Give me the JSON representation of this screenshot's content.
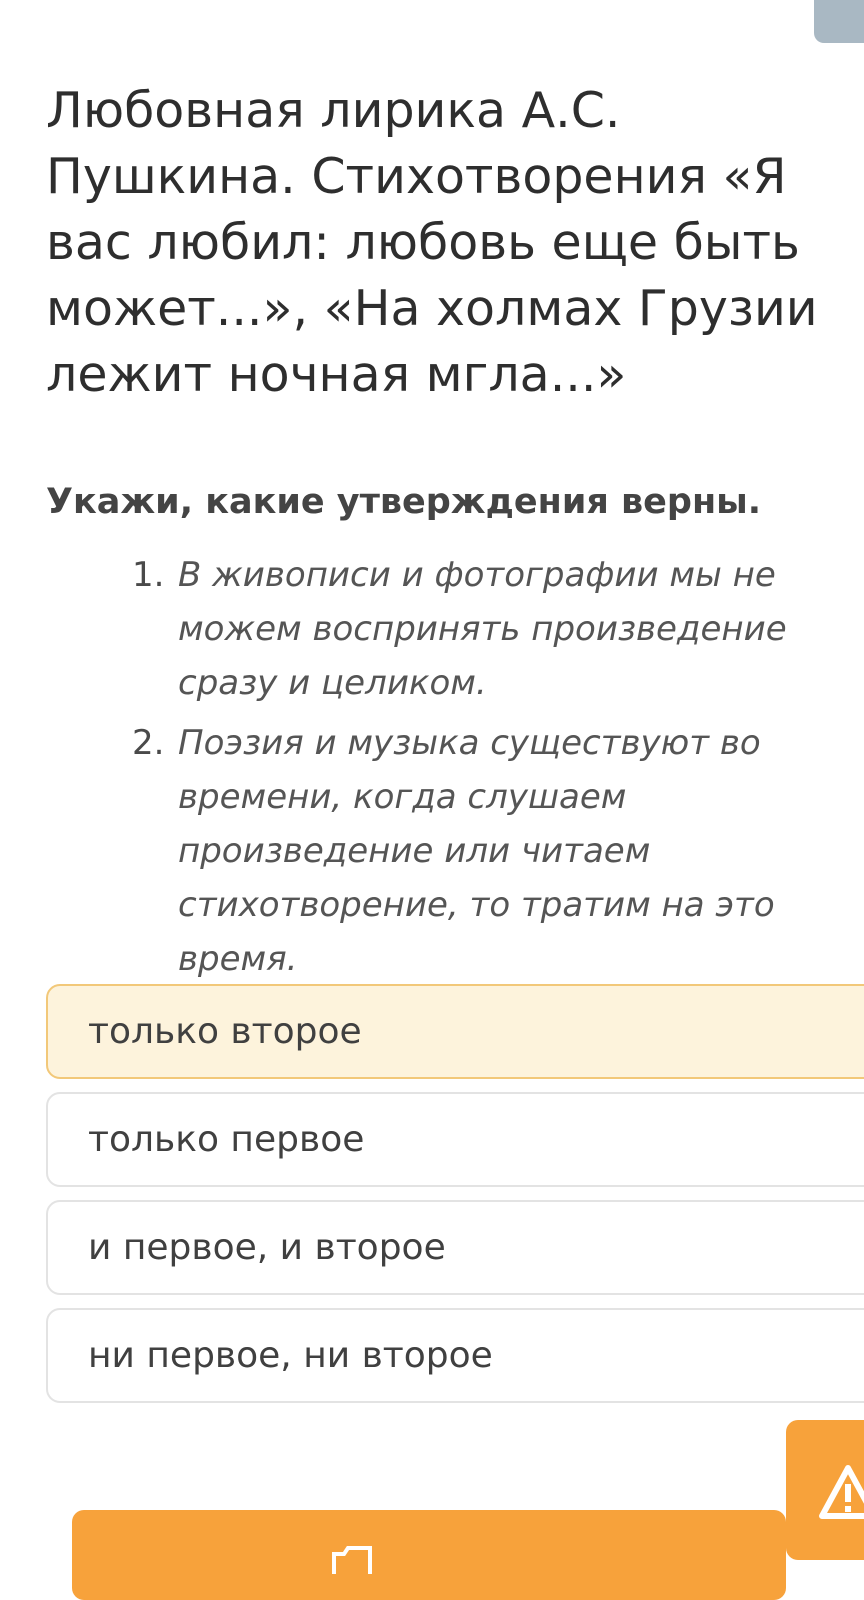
{
  "lesson": {
    "title": "Любовная лирика А.С. Пушкина. Стихотворения «Я вас любил: любовь еще быть может...», «На холмах Грузии лежит ночная мгла...»"
  },
  "question": {
    "prompt": "Укажи, какие утверждения верны.",
    "statements": [
      {
        "number": "1.",
        "text": "В живописи и фотографии мы не\nможем воспринять произведение\nсразу и целиком."
      },
      {
        "number": "2.",
        "text": "Поэзия и музыка существуют во\nвремени, когда слушаем\nпроизведение или читаем\nстихотворение, то тратим на это\nвремя."
      }
    ]
  },
  "options": [
    {
      "label": "только второе",
      "selected": true
    },
    {
      "label": "только первое",
      "selected": false
    },
    {
      "label": "и первое, и второе",
      "selected": false
    },
    {
      "label": "ни первое, ни второе",
      "selected": false
    }
  ],
  "colors": {
    "accent": "#f7a23b",
    "selected_background": "#fdf3dc",
    "selected_border": "#f2c879",
    "top_tab": "#a9b8c3"
  },
  "icons": {
    "report": "warning-triangle-icon"
  }
}
